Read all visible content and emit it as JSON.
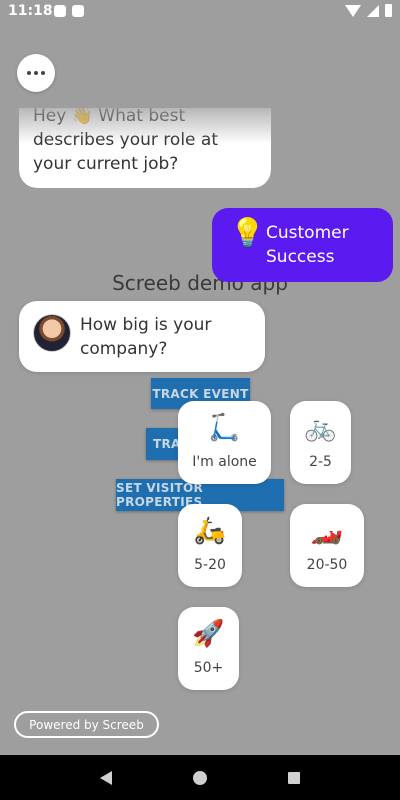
{
  "status_bar": {
    "time": "11:18"
  },
  "app": {
    "title": "Screeb demo app",
    "buttons": {
      "track_event": "TRACK EVENT",
      "track_partial": "TRA",
      "set_visitor": "SET VISITOR PROPERTIES"
    }
  },
  "survey": {
    "previous_question": "Hey 👋 What best describes your role at your current job?",
    "previous_answer": {
      "icon": "💡",
      "label": "Customer Success"
    },
    "question": "How big is your company?",
    "choices": [
      {
        "icon": "🛴",
        "label": "I'm alone"
      },
      {
        "icon": "🚲",
        "label": "2-5"
      },
      {
        "icon": "🛵",
        "label": "5-20"
      },
      {
        "icon": "🏎️",
        "label": "20-50"
      },
      {
        "icon": "🚀",
        "label": "50+"
      }
    ],
    "powered_by": "Powered by Screeb"
  }
}
